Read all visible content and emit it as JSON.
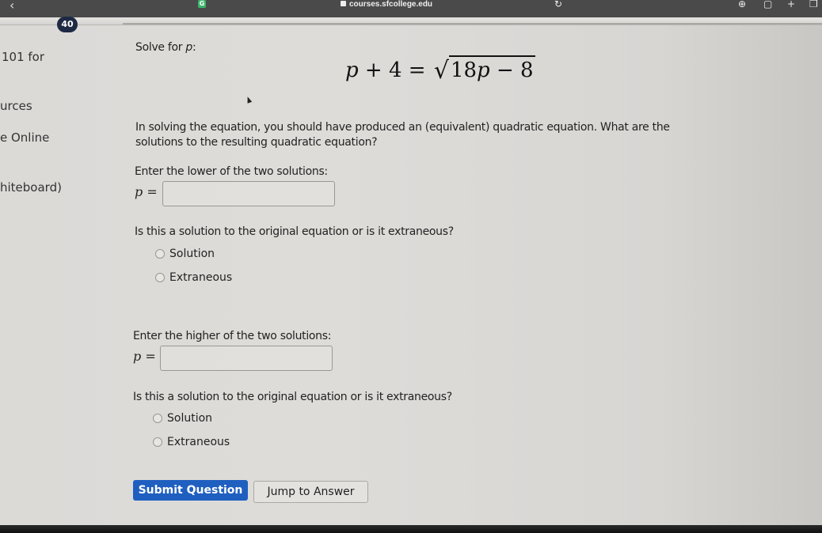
{
  "browser": {
    "url": "courses.sfcollege.edu",
    "icons": [
      "back-icon",
      "grammarly-extension-icon",
      "lock-icon",
      "reload-icon",
      "download-icon",
      "share-icon",
      "new-tab-icon",
      "tabs-overview-icon"
    ]
  },
  "badge": {
    "count": "40"
  },
  "sidebar": {
    "items": [
      {
        "label": "101 for"
      },
      {
        "label": "urces"
      },
      {
        "label": "e Online"
      },
      {
        "label": "hiteboard)"
      }
    ]
  },
  "question": {
    "prompt": "Solve for ",
    "prompt_var": "p",
    "prompt_colon": ":",
    "equation": {
      "lhs_var": "p",
      "lhs_rest": " + 4 = ",
      "radicand_num": "18",
      "radicand_var": "p",
      "radicand_rest": " − 8"
    },
    "instructions_line1": "In solving the equation, you should have produced an (equivalent) quadratic equation. What are the",
    "instructions_line2": "solutions to the resulting quadratic equation?",
    "part1": {
      "label": "Enter the lower of the two solutions:",
      "var": "p",
      "eq": " =",
      "value": "",
      "followup": "Is this a solution to the original equation or is it extraneous?",
      "options": [
        {
          "label": "Solution",
          "selected": false
        },
        {
          "label": "Extraneous",
          "selected": false
        }
      ]
    },
    "part2": {
      "label": "Enter the higher of the two solutions:",
      "var": "p",
      "eq": " =",
      "value": "",
      "followup": "Is this a solution to the original equation or is it extraneous?",
      "options": [
        {
          "label": "Solution",
          "selected": false
        },
        {
          "label": "Extraneous",
          "selected": false
        }
      ]
    }
  },
  "actions": {
    "submit_label": "Submit Question",
    "jump_label": "Jump to Answer"
  },
  "colors": {
    "primary": "#1f5fc0",
    "badge": "#1e2a44",
    "toolbar": "#4a4a4a"
  }
}
